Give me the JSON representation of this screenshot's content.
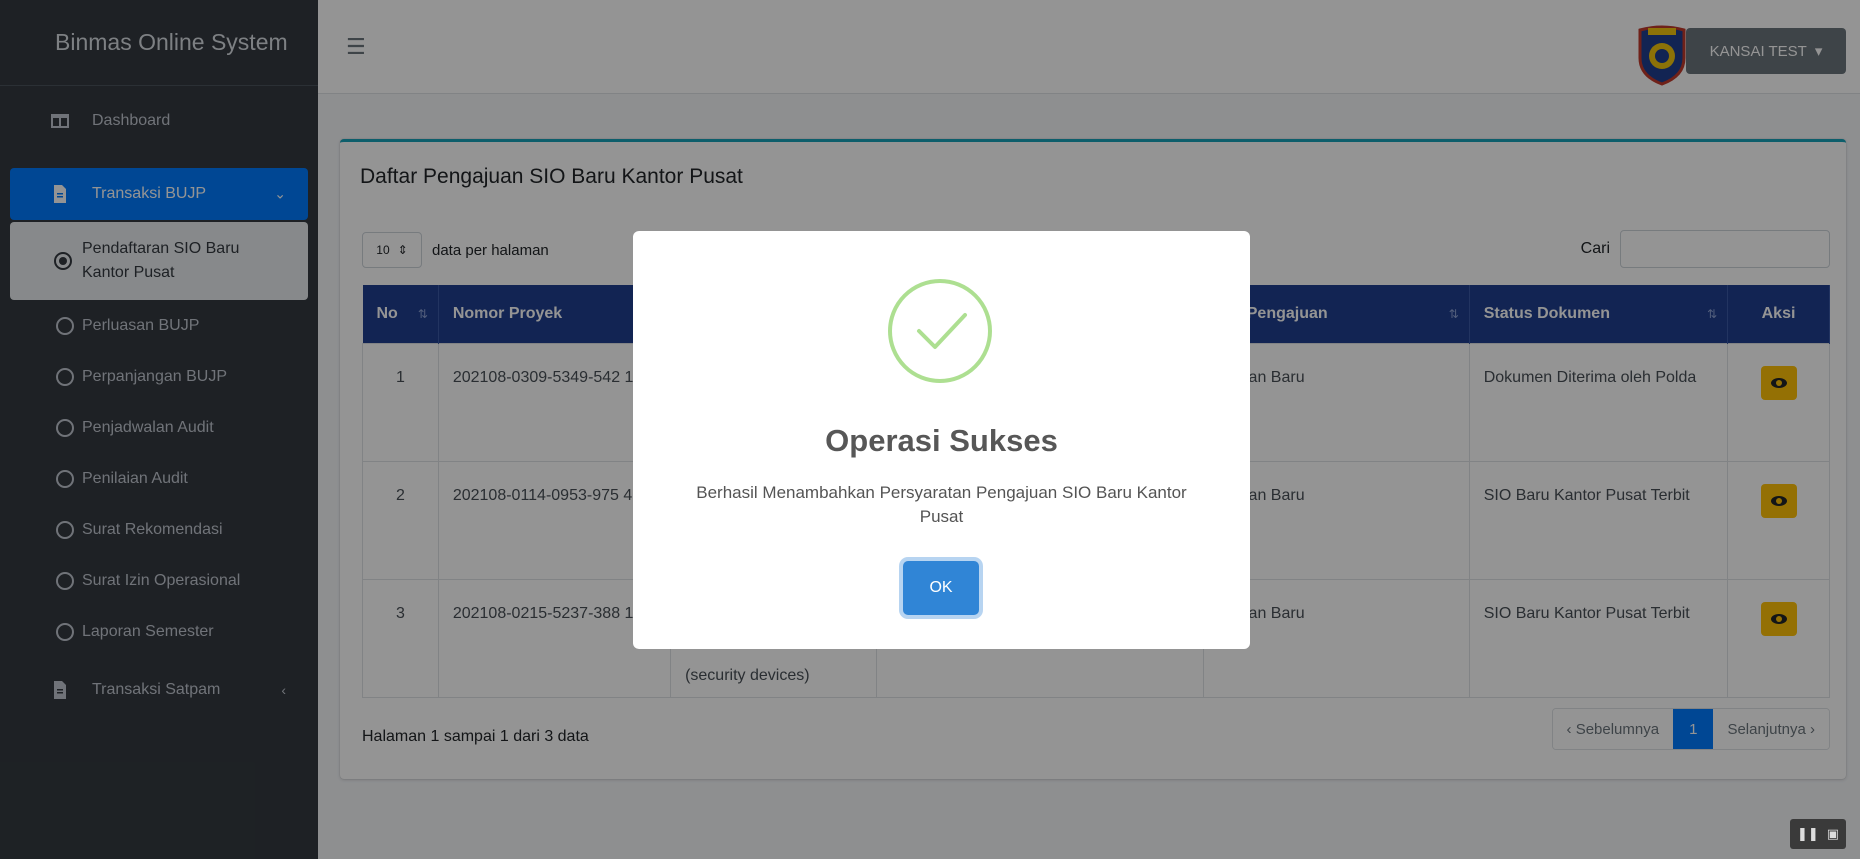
{
  "sidebar": {
    "brand": "Binmas Online System",
    "dashboard": "Dashboard",
    "transaksi_bujp": "Transaksi BUJP",
    "active_sub": "Pendaftaran SIO Baru Kantor Pusat",
    "items": [
      "Perluasan BUJP",
      "Perpanjangan BUJP",
      "Penjadwalan Audit",
      "Penilaian Audit",
      "Surat Rekomendasi",
      "Surat Izin Operasional",
      "Laporan Semester"
    ],
    "transaksi_satpam": "Transaksi Satpam",
    "accent_color": "#007bff"
  },
  "topbar": {
    "user": "KANSAI TEST",
    "menu_icon": "hamburger-icon"
  },
  "card": {
    "title": "Daftar Pengajuan SIO Baru Kantor Pusat",
    "length_value": "10",
    "length_label": "data per halaman",
    "search_label": "Cari",
    "search_value": "",
    "columns": [
      "No",
      "Nomor Proyek",
      "",
      "",
      "tus Pengajuan",
      "Status Dokumen",
      "Aksi"
    ],
    "rows": [
      {
        "no": "1",
        "proyek": "202108-0309-5349-542 199",
        "col3": "",
        "col4": "",
        "pengajuan": "gajuan Baru",
        "dokumen": "Dokumen Diterima oleh Polda"
      },
      {
        "no": "2",
        "proyek": "202108-0114-0953-975 429",
        "col3": "",
        "col4": "",
        "pengajuan": "gajuan Baru",
        "dokumen": "SIO Baru Kantor Pusat Terbit"
      },
      {
        "no": "3",
        "proyek": "202108-0215-5237-388 110",
        "col3": "(security devices)",
        "col4": "",
        "pengajuan": "gajuan Baru",
        "dokumen": "SIO Baru Kantor Pusat Terbit"
      }
    ],
    "info": "Halaman 1 sampai 1 dari 3 data",
    "pager": {
      "prev": "‹ Sebelumnya",
      "current": "1",
      "next": "Selanjutnya ›"
    }
  },
  "modal": {
    "title": "Operasi Sukses",
    "message": "Berhasil Menambahkan Persyaratan Pengajuan SIO Baru Kantor Pusat",
    "ok": "OK",
    "icon": "success-check-icon",
    "icon_color": "#a5dc86",
    "button_color": "#3085d6"
  }
}
